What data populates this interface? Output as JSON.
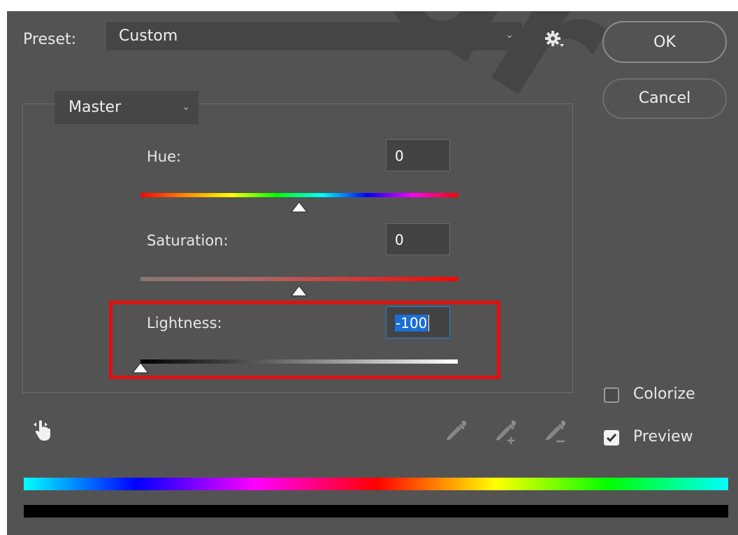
{
  "preset": {
    "label": "Preset:",
    "value": "Custom"
  },
  "buttons": {
    "ok": "OK",
    "cancel": "Cancel"
  },
  "channel": {
    "value": "Master"
  },
  "hue": {
    "label": "Hue:",
    "value": "0",
    "level": 0.5
  },
  "saturation": {
    "label": "Saturation:",
    "value": "0",
    "level": 0.5
  },
  "lightness": {
    "label": "Lightness:",
    "value": "-100",
    "level": 0.0
  },
  "options": {
    "colorize": {
      "label": "Colorize",
      "checked": false
    },
    "preview": {
      "label": "Preview",
      "checked": true
    }
  },
  "icons": {
    "settings": "gear-icon",
    "targeted_adjustment": "hand-icon",
    "eyedropper": "eyedropper-icon",
    "eyedropper_add": "eyedropper-plus-icon",
    "eyedropper_subtract": "eyedropper-minus-icon"
  },
  "colors": {
    "dialog_bg": "#535353",
    "highlight_box": "#e01010",
    "selection": "#1a6fd6"
  }
}
